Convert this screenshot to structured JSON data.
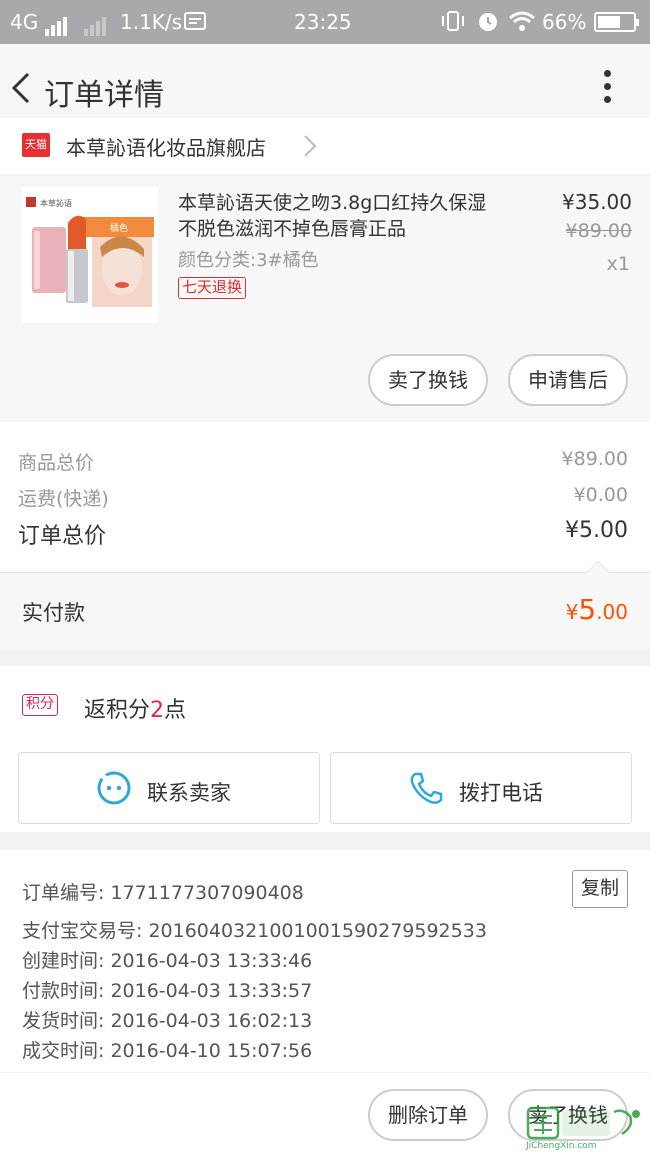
{
  "status_bar": {
    "network": "4G",
    "speed": "1.1K/s",
    "time": "23:25",
    "battery": "66%",
    "icons": [
      "signal-icon",
      "signal-dim-icon",
      "app-notify-icon",
      "vibrate-icon",
      "alarm-icon",
      "wifi-icon",
      "battery-icon"
    ]
  },
  "header": {
    "title": "订单详情"
  },
  "shop": {
    "badge": "天猫",
    "name": "本草訫语化妆品旗舰店"
  },
  "product": {
    "title": "本草訫语天使之吻3.8g口红持久保湿 不脱色滋润不掉色唇膏正品",
    "spec": "颜色分类:3#橘色",
    "tag": "七天退换",
    "price": "¥35.00",
    "original_price": "¥89.00",
    "quantity": "x1",
    "thumb_brand": "本草訫语",
    "thumb_label": "橘色"
  },
  "product_actions": {
    "sell_label": "卖了换钱",
    "aftersale_label": "申请售后"
  },
  "summary": {
    "goods_total_label": "商品总价",
    "goods_total_value": "¥89.00",
    "shipping_label": "运费(快递)",
    "shipping_value": "¥0.00",
    "order_total_label": "订单总价",
    "order_total_value": "¥5.00"
  },
  "paid": {
    "label": "实付款",
    "currency": "¥",
    "integer": "5",
    "decimal": ".00"
  },
  "points": {
    "badge": "积分",
    "text_prefix": "返积分",
    "value": "2",
    "text_suffix": "点"
  },
  "contact": {
    "seller_label": "联系卖家",
    "phone_label": "拨打电话"
  },
  "order_info": {
    "order_no": "订单编号: 1771177307090408",
    "copy_label": "复制",
    "alipay_no": "支付宝交易号: 2016040321001001590279592533",
    "created": "创建时间: 2016-04-03 13:33:46",
    "paid_time": "付款时间: 2016-04-03 13:33:57",
    "shipped": "发货时间: 2016-04-03 16:02:13",
    "completed": "成交时间: 2016-04-10 15:07:56"
  },
  "footer": {
    "delete_label": "删除订单",
    "sell_label": "卖了换钱"
  },
  "watermark": {
    "text": "JiChengXin.com"
  },
  "colors": {
    "accent_orange": "#ff5000",
    "tmall_red": "#e63034",
    "points_pink": "#e0245e",
    "icon_blue": "#2fa7d9"
  }
}
